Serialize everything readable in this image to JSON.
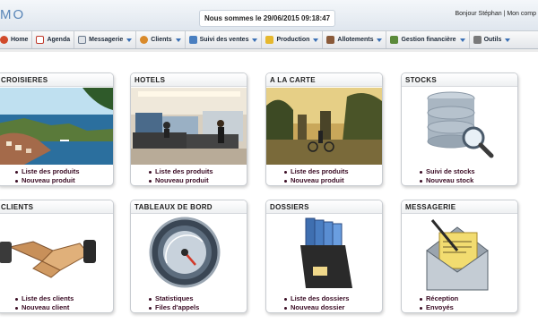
{
  "header": {
    "logo": "MO",
    "datetime": "Nous sommes le 29/06/2015 09:18:47",
    "greeting": "Bonjour Stéphan | Mon comp"
  },
  "menu": [
    {
      "label": "Home",
      "icon": "home-icon",
      "color": "#d14a2a",
      "dropdown": false
    },
    {
      "label": "Agenda",
      "icon": "calendar-icon",
      "color": "#c0392b",
      "dropdown": false
    },
    {
      "label": "Messagerie",
      "icon": "mail-icon",
      "color": "#6b7a8c",
      "dropdown": true
    },
    {
      "label": "Clients",
      "icon": "clients-icon",
      "color": "#d98a2b",
      "dropdown": true
    },
    {
      "label": "Suivi des ventes",
      "icon": "sales-icon",
      "color": "#4a7fc0",
      "dropdown": true
    },
    {
      "label": "Production",
      "icon": "folder-icon",
      "color": "#e6b82e",
      "dropdown": true
    },
    {
      "label": "Allotements",
      "icon": "allotment-icon",
      "color": "#8a5a3a",
      "dropdown": true
    },
    {
      "label": "Gestion financière",
      "icon": "finance-icon",
      "color": "#5b8a3a",
      "dropdown": true
    },
    {
      "label": "Outils",
      "icon": "tools-icon",
      "color": "#7a7a7a",
      "dropdown": true
    }
  ],
  "cards": {
    "croisieres": {
      "title": "CROISIERES",
      "links": [
        "Liste des produits",
        "Nouveau produit"
      ]
    },
    "hotels": {
      "title": "HOTELS",
      "links": [
        "Liste des produits",
        "Nouveau produit"
      ]
    },
    "alacarte": {
      "title": "A LA CARTE",
      "links": [
        "Liste des produits",
        "Nouveau produit"
      ]
    },
    "stocks": {
      "title": "STOCKS",
      "links": [
        "Suivi de stocks",
        "Nouveau stock"
      ]
    },
    "clients": {
      "title": "CLIENTS",
      "links": [
        "Liste des clients",
        "Nouveau client"
      ]
    },
    "tableaux": {
      "title": "TABLEAUX DE BORD",
      "links": [
        "Statistiques",
        "Files d'appels"
      ]
    },
    "dossiers": {
      "title": "DOSSIERS",
      "links": [
        "Liste des dossiers",
        "Nouveau dossier"
      ]
    },
    "messagerie": {
      "title": "MESSAGERIE",
      "links": [
        "Réception",
        "Envoyés"
      ]
    }
  },
  "colors": {
    "link": "#3b0d25",
    "accent": "#3a6fb4"
  }
}
